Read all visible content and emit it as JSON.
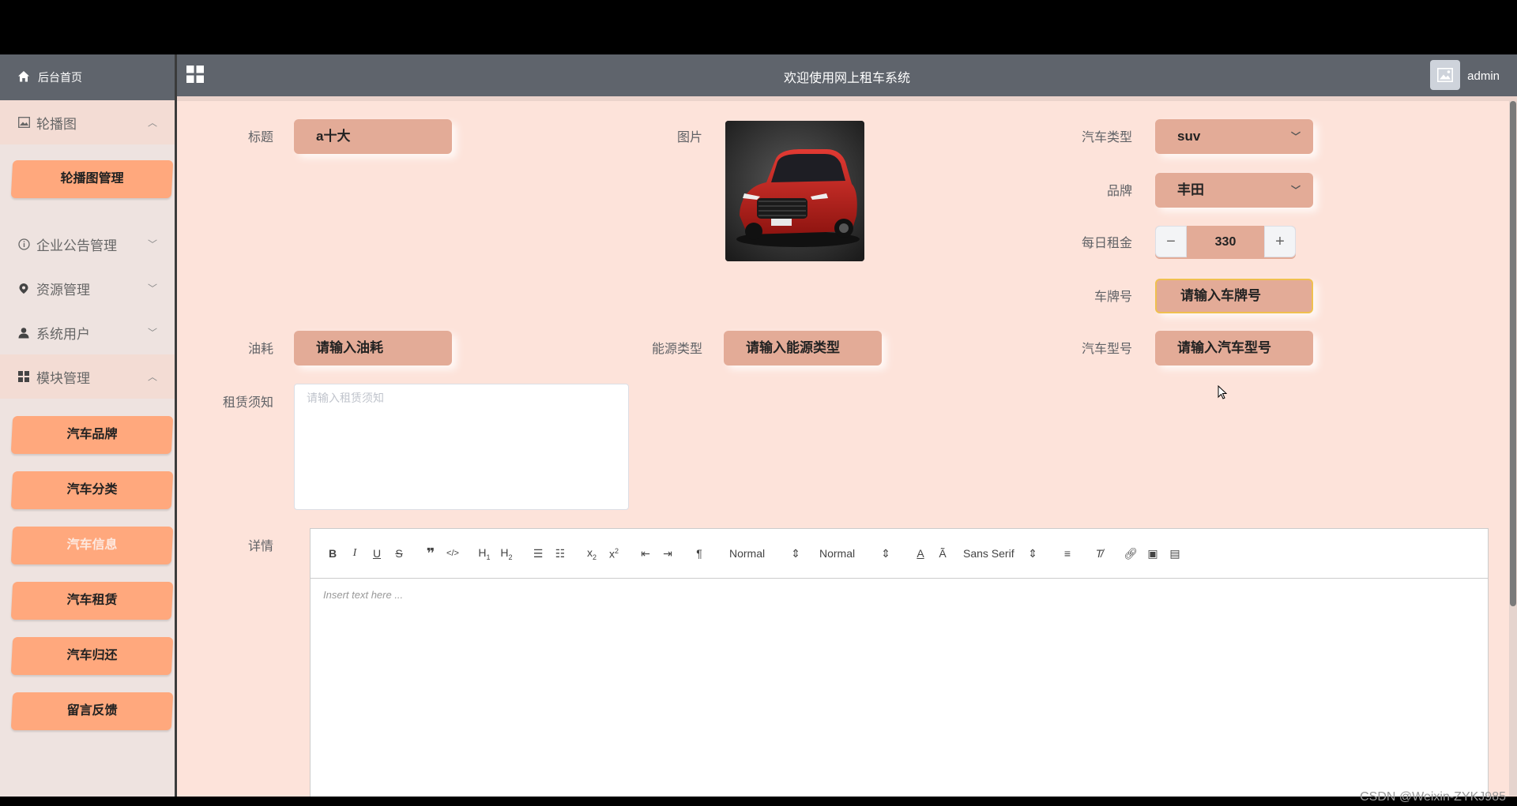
{
  "header": {
    "site_title": "欢迎使用网上租车系统",
    "user": "admin"
  },
  "sidebar": {
    "home": "后台首页",
    "groups": [
      {
        "label": "轮播图",
        "icon": "image-icon",
        "expanded": true,
        "items": [
          "轮播图管理"
        ]
      },
      {
        "label": "企业公告管理",
        "icon": "info-circle-icon",
        "expanded": false,
        "items": []
      },
      {
        "label": "资源管理",
        "icon": "location-icon",
        "expanded": false,
        "items": []
      },
      {
        "label": "系统用户",
        "icon": "user-icon",
        "expanded": false,
        "items": []
      },
      {
        "label": "模块管理",
        "icon": "grid-icon",
        "expanded": true,
        "items": [
          "汽车品牌",
          "汽车分类",
          "汽车信息",
          "汽车租赁",
          "汽车归还",
          "留言反馈"
        ]
      }
    ],
    "active_item": "汽车信息"
  },
  "form": {
    "title_label": "标题",
    "title_value": "a十大",
    "image_label": "图片",
    "car_type_label": "汽车类型",
    "car_type_value": "suv",
    "brand_label": "品牌",
    "brand_value": "丰田",
    "daily_rent_label": "每日租金",
    "daily_rent_value": "330",
    "plate_label": "车牌号",
    "plate_placeholder": "请输入车牌号",
    "fuel_label": "油耗",
    "fuel_placeholder": "请输入油耗",
    "energy_label": "能源类型",
    "energy_placeholder": "请输入能源类型",
    "model_label": "汽车型号",
    "model_placeholder": "请输入汽车型号",
    "notice_label": "租赁须知",
    "notice_placeholder": "请输入租赁须知",
    "detail_label": "详情"
  },
  "editor": {
    "header_select": "Normal",
    "size_select": "Normal",
    "font_select": "Sans Serif",
    "placeholder": "Insert text here ..."
  },
  "watermark": "CSDN @Weixin-ZYKJ985"
}
